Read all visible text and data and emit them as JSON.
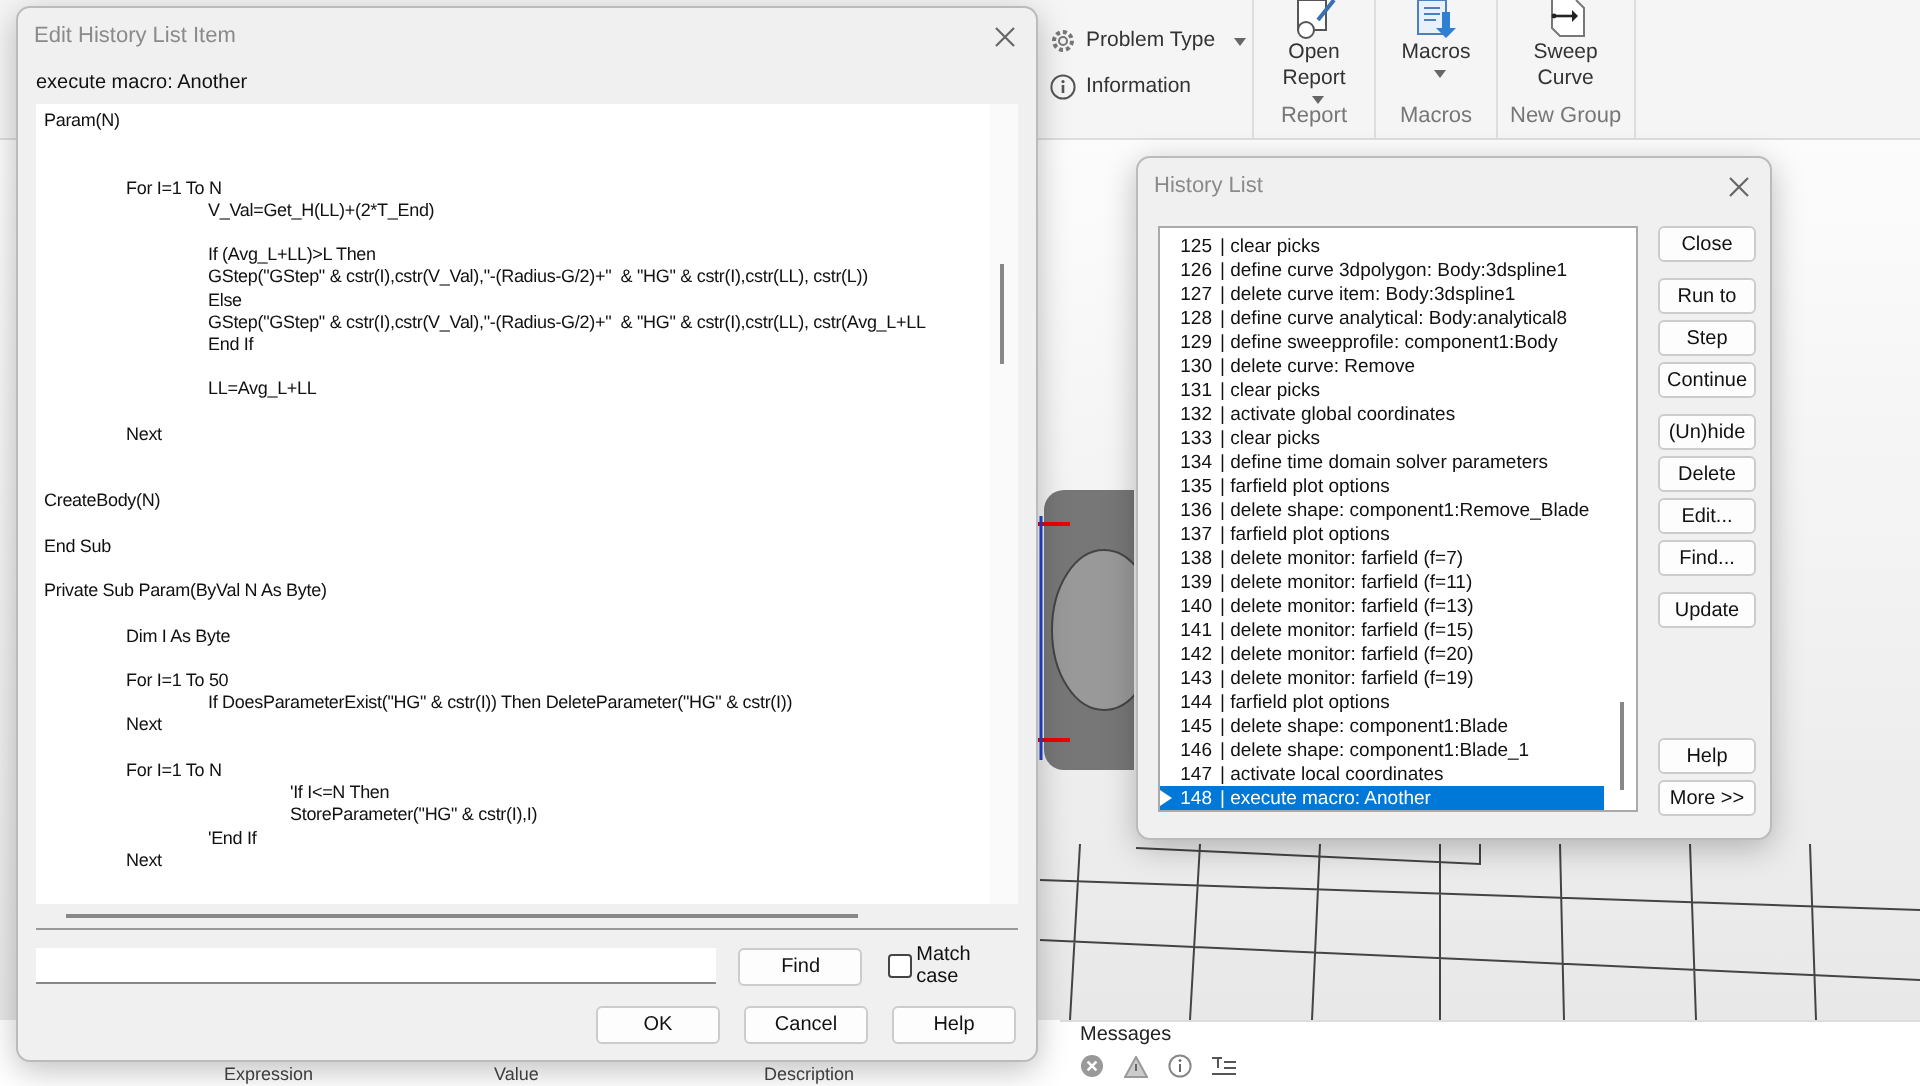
{
  "ribbon": {
    "small_buttons": [
      {
        "label": "Problem Type",
        "has_menu": true
      },
      {
        "label": "Information",
        "has_menu": false
      }
    ],
    "groups": [
      {
        "label": "Report",
        "buttons": [
          {
            "label": "Open Report",
            "has_menu": true
          }
        ]
      },
      {
        "label": "Macros",
        "buttons": [
          {
            "label": "Macros",
            "has_menu": true
          }
        ]
      },
      {
        "label": "New Group",
        "buttons": [
          {
            "label": "Sweep Curve",
            "has_menu": false
          }
        ]
      }
    ]
  },
  "parameters_table": {
    "columns": [
      "Expression",
      "Value",
      "Description"
    ]
  },
  "messages": {
    "title": "Messages"
  },
  "edit_dialog": {
    "title": "Edit History List Item",
    "item_label": "execute macro: Another",
    "code": "Param(N)\n\n\n\tFor I=1 To N\n\t\tV_Val=Get_H(LL)+(2*T_End)\n\n\t\tIf (Avg_L+LL)>L Then\n\t\tGStep(\"GStep\" & cstr(I),cstr(V_Val),\"-(Radius-G/2)+\"  & \"HG\" & cstr(I),cstr(LL), cstr(L))\n\t\tElse\n\t\tGStep(\"GStep\" & cstr(I),cstr(V_Val),\"-(Radius-G/2)+\"  & \"HG\" & cstr(I),cstr(LL), cstr(Avg_L+LL\n\t\tEnd If\n\n\t\tLL=Avg_L+LL\n\n\tNext\n\n\nCreateBody(N)\n\nEnd Sub\n\nPrivate Sub Param(ByVal N As Byte)\n\n\tDim I As Byte\n\n\tFor I=1 To 50\n\t\tIf DoesParameterExist(\"HG\" & cstr(I)) Then DeleteParameter(\"HG\" & cstr(I))\n\tNext\n\n\tFor I=1 To N\n\t\t\t'If I<=N Then\n\t\t\tStoreParameter(\"HG\" & cstr(I),I)\n\t\t'End If\n\tNext",
    "find_button": "Find",
    "match_case": {
      "label": "Match case",
      "checked": false
    },
    "buttons": [
      "OK",
      "Cancel",
      "Help"
    ]
  },
  "history_dialog": {
    "title": "History List",
    "rows": [
      {
        "number": "125",
        "text": "| clear picks",
        "selected": false
      },
      {
        "number": "126",
        "text": "| define curve 3dpolygon: Body:3dspline1",
        "selected": false
      },
      {
        "number": "127",
        "text": "| delete curve item: Body:3dspline1",
        "selected": false
      },
      {
        "number": "128",
        "text": "| define curve analytical: Body:analytical8",
        "selected": false
      },
      {
        "number": "129",
        "text": "| define sweepprofile: component1:Body",
        "selected": false
      },
      {
        "number": "130",
        "text": "| delete curve: Remove",
        "selected": false
      },
      {
        "number": "131",
        "text": "| clear picks",
        "selected": false
      },
      {
        "number": "132",
        "text": "| activate global coordinates",
        "selected": false
      },
      {
        "number": "133",
        "text": "| clear picks",
        "selected": false
      },
      {
        "number": "134",
        "text": "| define time domain solver parameters",
        "selected": false
      },
      {
        "number": "135",
        "text": "| farfield plot options",
        "selected": false
      },
      {
        "number": "136",
        "text": "| delete shape: component1:Remove_Blade",
        "selected": false
      },
      {
        "number": "137",
        "text": "| farfield plot options",
        "selected": false
      },
      {
        "number": "138",
        "text": "| delete monitor: farfield (f=7)",
        "selected": false
      },
      {
        "number": "139",
        "text": "| delete monitor: farfield (f=11)",
        "selected": false
      },
      {
        "number": "140",
        "text": "| delete monitor: farfield (f=13)",
        "selected": false
      },
      {
        "number": "141",
        "text": "| delete monitor: farfield (f=15)",
        "selected": false
      },
      {
        "number": "142",
        "text": "| delete monitor: farfield (f=20)",
        "selected": false
      },
      {
        "number": "143",
        "text": "| delete monitor: farfield (f=19)",
        "selected": false
      },
      {
        "number": "144",
        "text": "| farfield plot options",
        "selected": false
      },
      {
        "number": "145",
        "text": "| delete shape: component1:Blade",
        "selected": false
      },
      {
        "number": "146",
        "text": "| delete shape: component1:Blade_1",
        "selected": false
      },
      {
        "number": "147",
        "text": "| activate local coordinates",
        "selected": false
      },
      {
        "number": "148",
        "text": "| execute macro: Another",
        "selected": true
      }
    ],
    "button_groups": [
      [
        "Close"
      ],
      [
        "Run to",
        "Step",
        "Continue"
      ],
      [
        "(Un)hide",
        "Delete",
        "Edit...",
        "Find..."
      ],
      [
        "Update"
      ],
      [
        "Help",
        "More >>"
      ]
    ]
  }
}
